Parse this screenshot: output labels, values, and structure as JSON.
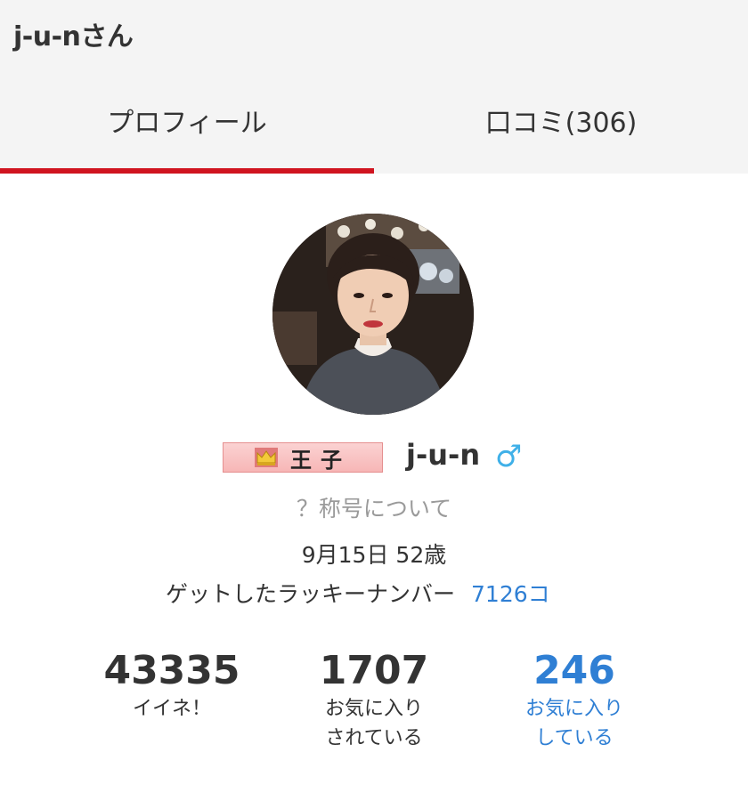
{
  "header": {
    "title": "j-u-nさん"
  },
  "tabs": [
    {
      "label": "プロフィール",
      "active": true
    },
    {
      "label": "口コミ(306)",
      "active": false
    }
  ],
  "profile": {
    "badge_text": "王子",
    "badge_icon": "crown-icon",
    "username": "j-u-n",
    "gender_symbol": "♂",
    "title_help": "？称号について",
    "birthday": "9月15日 52歳",
    "lucky_label": "ゲットしたラッキーナンバー",
    "lucky_value": "7126コ"
  },
  "stats": [
    {
      "value": "43335",
      "label_line1": "イイネ！",
      "label_line2": ""
    },
    {
      "value": "1707",
      "label_line1": "お気に入り",
      "label_line2": "されている"
    },
    {
      "value": "246",
      "label_line1": "お気に入り",
      "label_line2": "している"
    }
  ],
  "colors": {
    "tab_indicator": "#d0141f",
    "link_blue": "#2f7fd4",
    "gender_blue": "#3fb0e8",
    "header_bg": "#f4f4f4"
  }
}
